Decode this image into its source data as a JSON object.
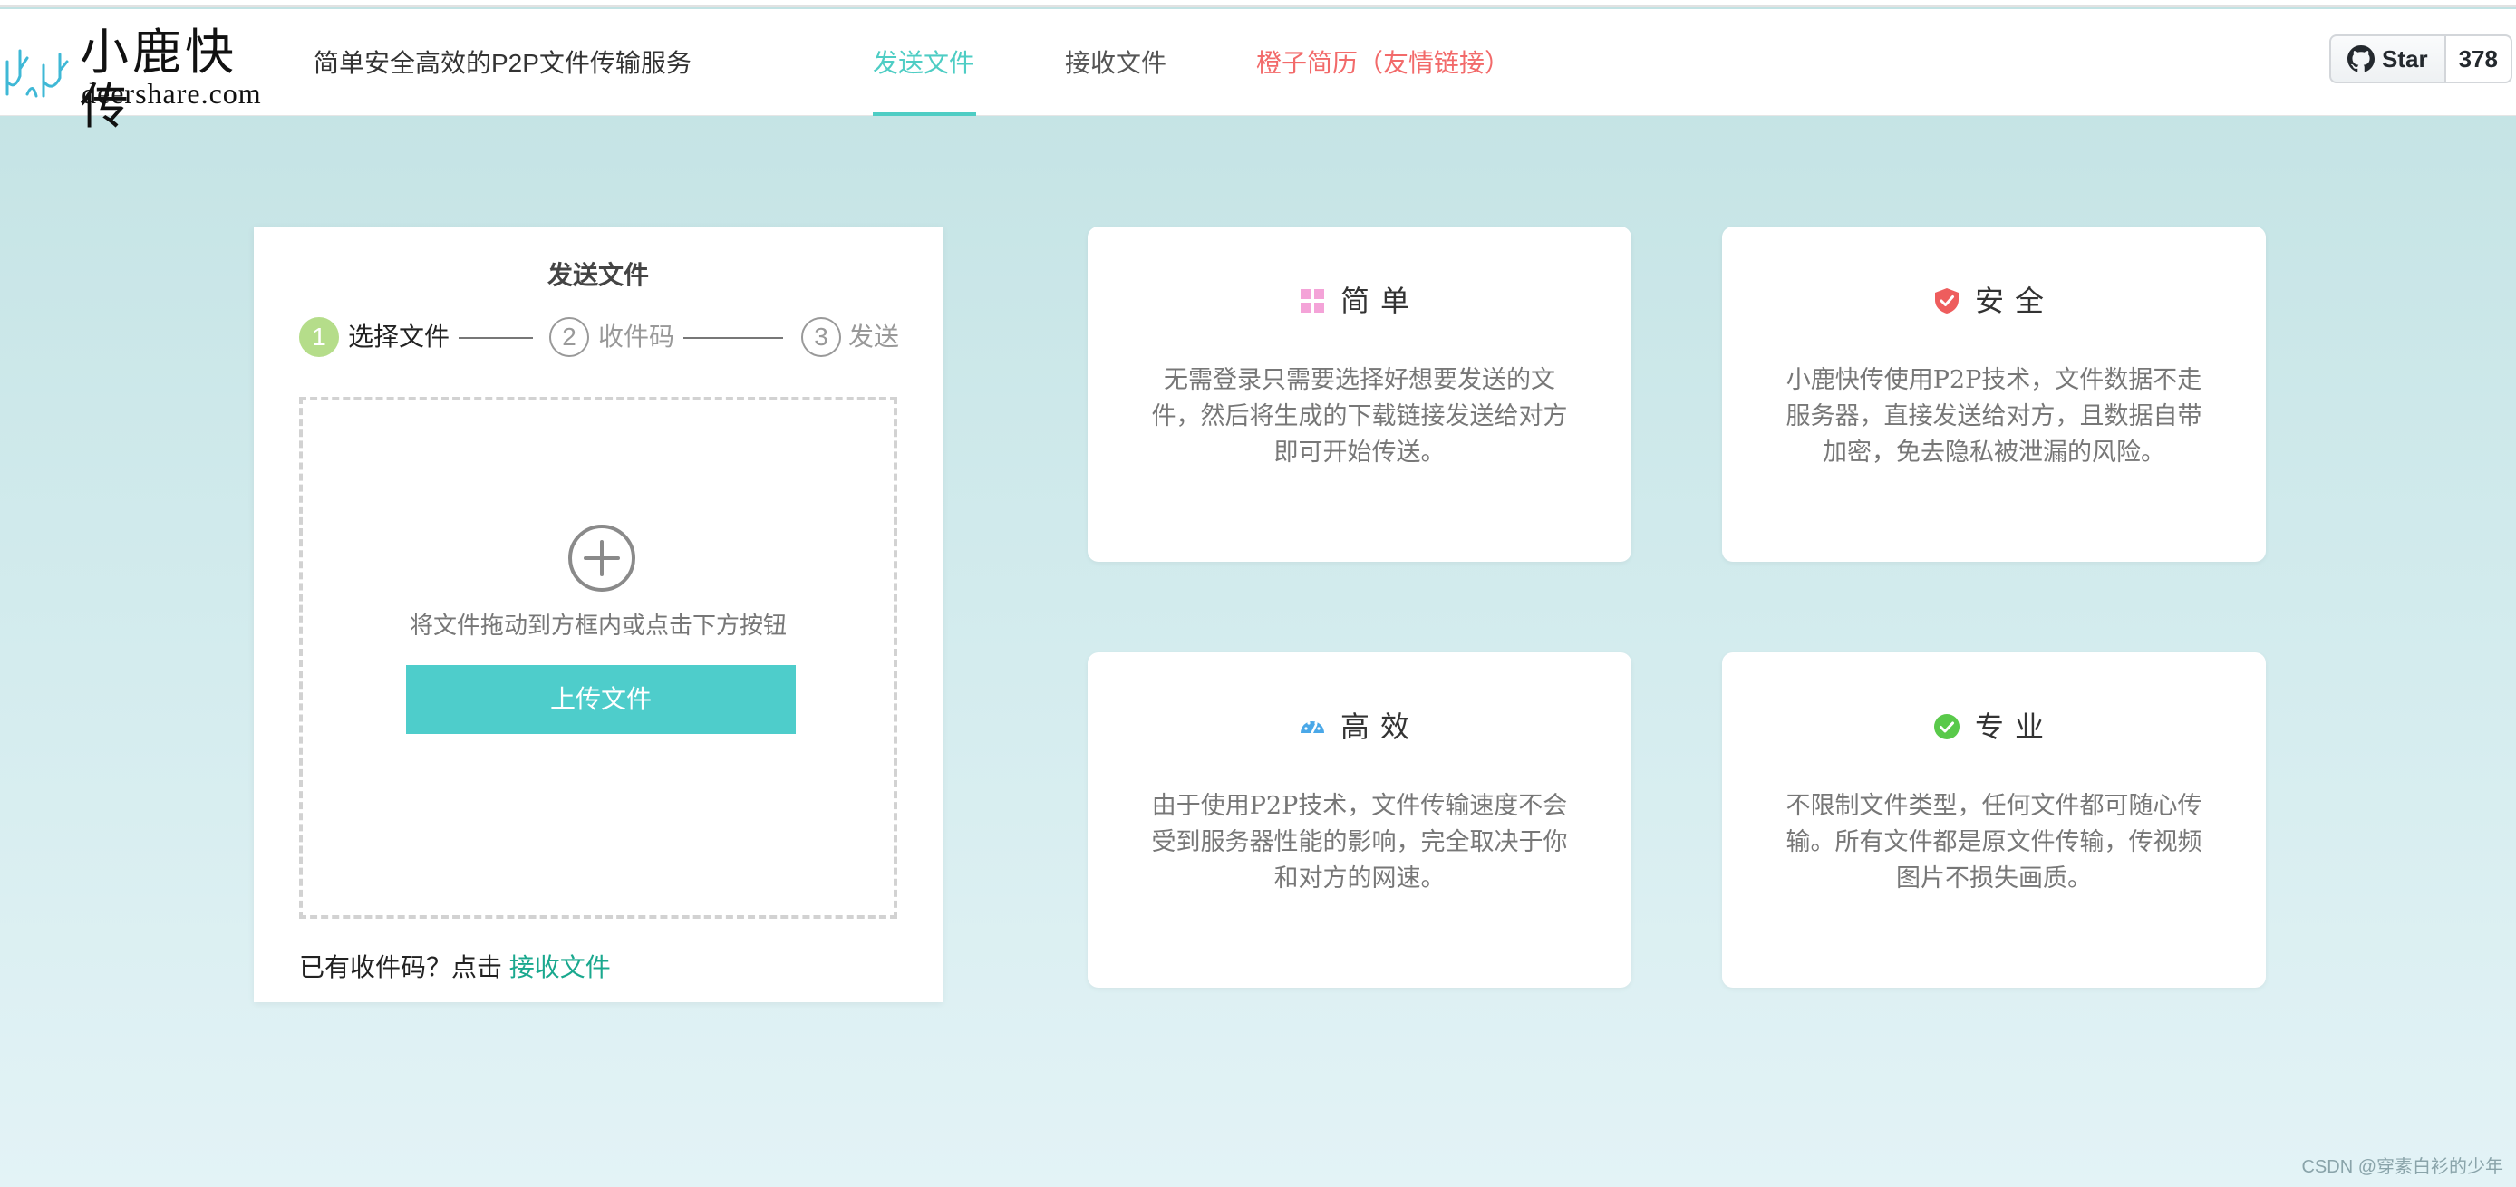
{
  "header": {
    "logo_cn": "小鹿快传",
    "logo_en": "deershare.com",
    "tagline": "简单安全高效的P2P文件传输服务",
    "nav": [
      {
        "label": "发送文件",
        "active": true
      },
      {
        "label": "接收文件",
        "active": false
      },
      {
        "label": "橙子简历（友情链接）",
        "active": false
      }
    ],
    "github": {
      "star_label": "Star",
      "count": "378",
      "icon": "github-icon"
    }
  },
  "send_panel": {
    "title": "发送文件",
    "steps": [
      {
        "num": "1",
        "label": "选择文件",
        "active": true
      },
      {
        "num": "2",
        "label": "收件码",
        "active": false
      },
      {
        "num": "3",
        "label": "发送",
        "active": false
      }
    ],
    "drop_hint": "将文件拖动到方框内或点击下方按钮",
    "upload_label": "上传文件",
    "have_code_prefix": "已有收件码？点击 ",
    "have_code_link": "接收文件"
  },
  "features": [
    {
      "title": "简单",
      "icon": "grid-icon",
      "color": "#f4a3d8",
      "text": "无需登录只需要选择好想要发送的文件，然后将生成的下载链接发送给对方即可开始传送。"
    },
    {
      "title": "安全",
      "icon": "shield-icon",
      "color": "#ee5d5d",
      "text": "小鹿快传使用P2P技术，文件数据不走服务器，直接发送给对方，且数据自带加密，免去隐私被泄漏的风险。"
    },
    {
      "title": "高效",
      "icon": "speedometer-icon",
      "color": "#4aa8e8",
      "text": "由于使用P2P技术，文件传输速度不会受到服务器性能的影响，完全取决于你和对方的网速。"
    },
    {
      "title": "专业",
      "icon": "check-circle-icon",
      "color": "#59c94a",
      "text": "不限制文件类型，任何文件都可随心传输。所有文件都是原文件传输，传视频图片不损失画质。"
    }
  ],
  "watermark": "CSDN @穿素白衫的少年",
  "colors": {
    "accent": "#4ecdc4",
    "link_red": "#f26a6a",
    "step_active": "#b5dd8a"
  }
}
